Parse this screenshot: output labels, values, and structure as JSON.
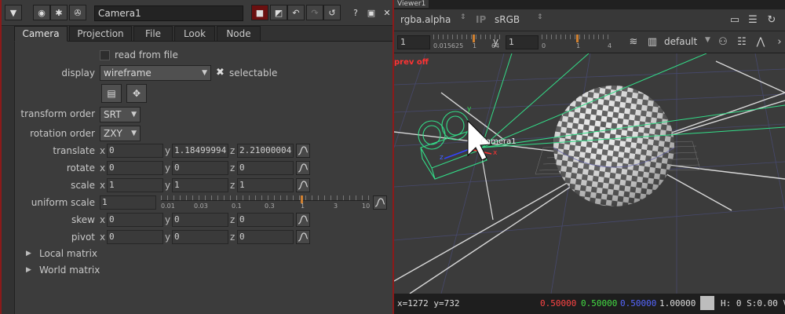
{
  "panel": {
    "node_name": "Camera1",
    "tabs": [
      "Camera",
      "Projection",
      "File",
      "Look",
      "Node"
    ],
    "active_tab": "Camera",
    "header_icons": [
      "collapse-icon",
      "settings-circle-icon",
      "bug-icon",
      "wrench-icon"
    ],
    "header_right_icons": [
      "red-node-color-icon",
      "split-color-icon",
      "undo-icon",
      "redo-icon",
      "revert-icon",
      "help-icon",
      "float-panel-icon",
      "close-icon"
    ],
    "help_label": "?",
    "close_label": "✕"
  },
  "props": {
    "read_from_file": "read from file",
    "display_label": "display",
    "display_value": "wireframe",
    "selectable_label": "selectable",
    "transform_order_label": "transform order",
    "transform_order_value": "SRT",
    "rotation_order_label": "rotation order",
    "rotation_order_value": "ZXY",
    "translate_label": "translate",
    "translate": {
      "x": "0",
      "y": "1.18499994",
      "z": "2.21000004"
    },
    "rotate_label": "rotate",
    "rotate": {
      "x": "0",
      "y": "0",
      "z": "0"
    },
    "scale_label": "scale",
    "scale": {
      "x": "1",
      "y": "1",
      "z": "1"
    },
    "uniform_scale_label": "uniform scale",
    "uniform_scale_value": "1",
    "uniform_scale_ticks": [
      "0.01",
      "0.03",
      "0.1",
      "0.3",
      "1",
      "3",
      "10"
    ],
    "skew_label": "skew",
    "skew": {
      "x": "0",
      "y": "0",
      "z": "0"
    },
    "pivot_label": "pivot",
    "pivot": {
      "x": "0",
      "y": "0",
      "z": "0"
    },
    "local_matrix": "Local matrix",
    "world_matrix": "World matrix",
    "axis_x": "x",
    "axis_y": "y",
    "axis_z": "z"
  },
  "viewer": {
    "tab_label": "Viewer1",
    "channels": "rgba.alpha",
    "ip_label": "IP",
    "colorspace": "sRGB",
    "gain_value": "1",
    "gain_ticks": [
      "0.015625",
      "1",
      "64"
    ],
    "gamma_label": "y",
    "gamma_value": "1",
    "gamma_ticks": [
      "0",
      "1",
      "4"
    ],
    "view_mode": "default",
    "proxy_warning": "prev off",
    "camera_label": "Camera1",
    "axis_x": "x",
    "axis_y": "y",
    "axis_z": "z"
  },
  "status": {
    "coords": "x=1272 y=732",
    "r": "0.50000",
    "g": "0.50000",
    "b": "0.50000",
    "a": "1.00000",
    "hsv": "H:  0 S:0.00 V"
  },
  "colors": {
    "frame_red": "#8b1a1a",
    "status_red": "#ff4444",
    "status_green": "#44dd44",
    "status_blue": "#5566ff",
    "camera_green": "#33dd88"
  }
}
